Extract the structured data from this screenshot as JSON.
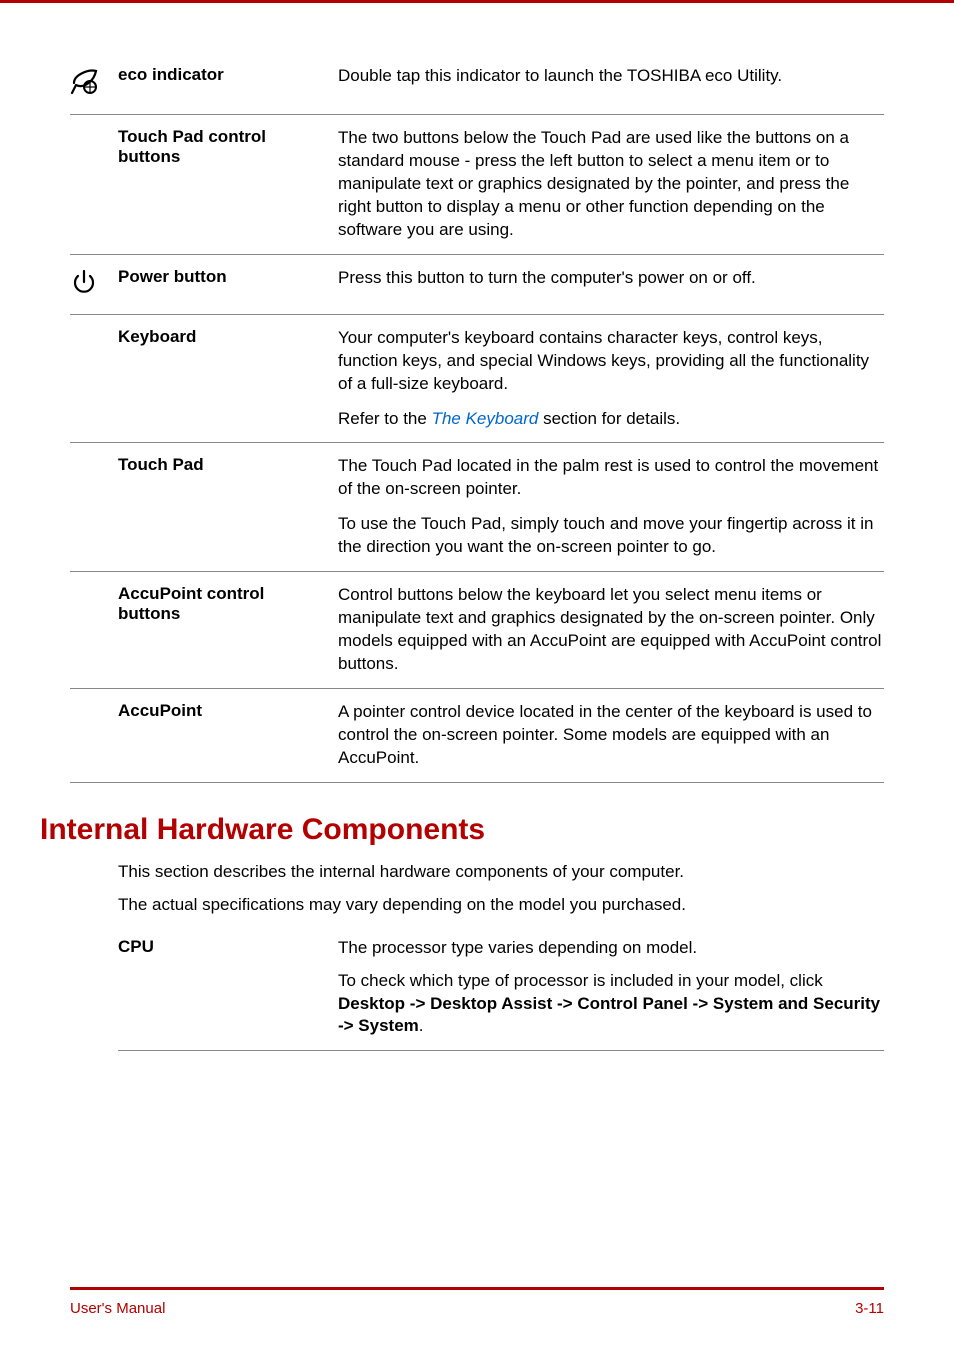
{
  "rows": [
    {
      "label": "eco indicator",
      "p1": "Double tap this indicator to launch the TOSHIBA eco Utility."
    },
    {
      "label": "Touch Pad control buttons",
      "p1": "The two buttons below the Touch Pad are used like the buttons on a standard mouse - press the left button to select a menu item or to manipulate text or graphics designated by the pointer, and press the right button to display a menu or other function depending on the software you are using."
    },
    {
      "label": "Power button",
      "p1": "Press this button to turn the computer's power on or off."
    },
    {
      "label": "Keyboard",
      "p1": "Your computer's keyboard contains character keys, control keys, function keys, and special Windows keys, providing all the functionality of a full-size keyboard.",
      "link_pre": "Refer to the ",
      "link_text": "The Keyboard",
      "link_post": " section for details."
    },
    {
      "label": "Touch Pad",
      "p1": "The Touch Pad located in the palm rest is used to control the movement of the on-screen pointer.",
      "p2": "To use the Touch Pad, simply touch and move your fingertip across it in the direction you want the on-screen pointer to go."
    },
    {
      "label": "AccuPoint control buttons",
      "p1": "Control buttons below the keyboard let you select menu items or manipulate text and graphics designated by the on-screen pointer. Only models equipped with an AccuPoint are equipped with AccuPoint control buttons."
    },
    {
      "label": "AccuPoint",
      "p1": "A pointer control device located in the center of the keyboard is used to control the on-screen pointer. Some models are equipped with an AccuPoint."
    }
  ],
  "section": {
    "heading": "Internal Hardware Components",
    "intro1": "This section describes the internal hardware components of your computer.",
    "intro2": "The actual specifications may vary depending on the model you purchased."
  },
  "cpu": {
    "label": "CPU",
    "p1": "The processor type varies depending on model.",
    "p2a": "To check which type of processor is included in your model, click ",
    "p2b": "Desktop -> Desktop Assist -> Control Panel -> System and Security -> System",
    "p2c": "."
  },
  "footer": {
    "left": "User's Manual",
    "right": "3-11"
  }
}
